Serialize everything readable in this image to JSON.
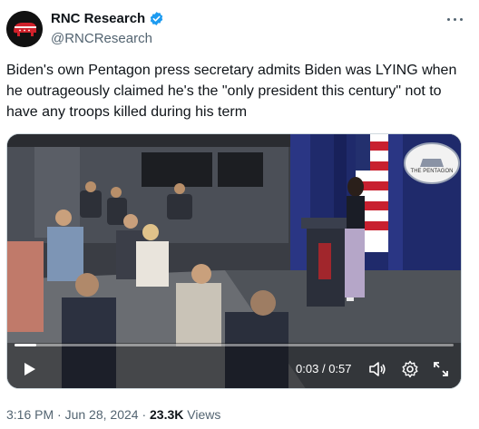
{
  "account": {
    "name": "RNC Research",
    "handle": "@RNCResearch",
    "avatar_icon": "elephant-logo-icon",
    "verified": true,
    "accent": "#1d9bf0"
  },
  "tweet": {
    "text": "Biden's own Pentagon press secretary admits Biden was LYING when he outrageously claimed he's the \"only president this century\" not to have any troops killed during his term"
  },
  "video": {
    "seal_text": "THE PENTAGON",
    "current_time": "0:03",
    "separator": "/",
    "duration": "0:57",
    "progress": 0.05
  },
  "meta": {
    "time": "3:16 PM",
    "dot1": "·",
    "date": "Jun 28, 2024",
    "dot2": "·",
    "views_count": "23.3K",
    "views_label": "Views"
  }
}
